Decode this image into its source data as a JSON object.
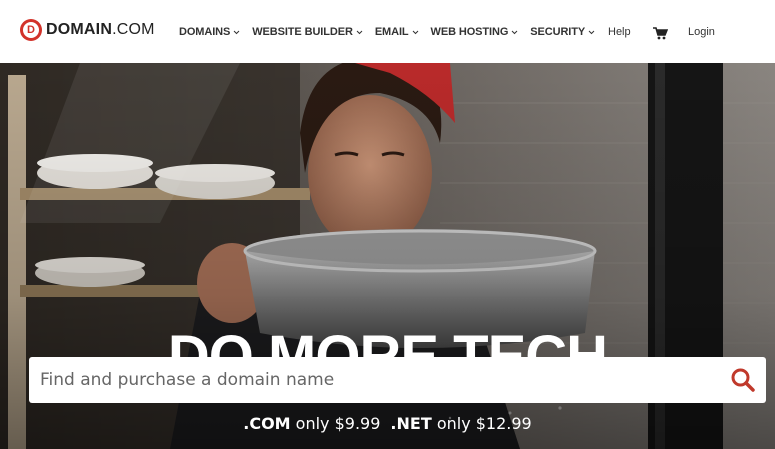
{
  "logo": {
    "mark": "D",
    "text_bold": "DOMAIN",
    "text_light": ".COM"
  },
  "nav": {
    "items": [
      {
        "label": "DOMAINS"
      },
      {
        "label": "WEBSITE BUILDER"
      },
      {
        "label": "EMAIL"
      },
      {
        "label": "WEB HOSTING"
      },
      {
        "label": "SECURITY"
      }
    ],
    "help": "Help",
    "cart_icon": "cart-icon",
    "login": "Login"
  },
  "hero": {
    "headline_before": "DO MORE",
    "headline_dot": ".",
    "headline_after": "TECH",
    "search": {
      "placeholder": "Find and purchase a domain name",
      "button_icon": "search-icon"
    },
    "pricing": [
      {
        "tld": ".COM",
        "text": " only $9.99"
      },
      {
        "tld": ".NET",
        "text": " only $12.99"
      }
    ]
  },
  "colors": {
    "brand_red": "#d2322a",
    "accent_red": "#e03a2f",
    "text_dark": "#333333",
    "white": "#ffffff"
  }
}
